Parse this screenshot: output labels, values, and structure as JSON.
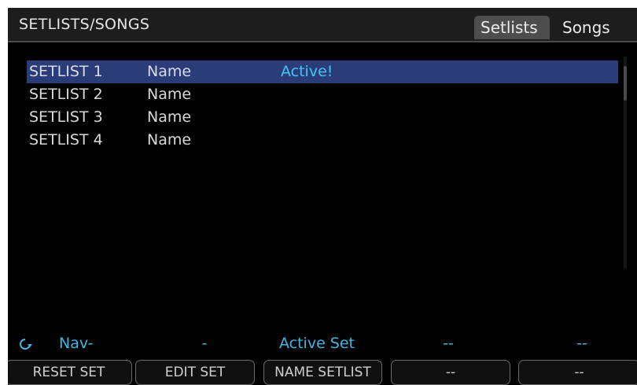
{
  "header": {
    "title": "SETLISTS/SONGS",
    "tabs": [
      "Setlists",
      "Songs"
    ],
    "active_tab": "Setlists"
  },
  "setlists": [
    {
      "label": "SETLIST 1",
      "name": "Name",
      "status": "Active!"
    },
    {
      "label": "SETLIST 2",
      "name": "Name",
      "status": ""
    },
    {
      "label": "SETLIST 3",
      "name": "Name",
      "status": ""
    },
    {
      "label": "SETLIST 4",
      "name": "Name",
      "status": ""
    }
  ],
  "selected_index": 0,
  "info_bar": {
    "icon": "rotary-knob-icon",
    "items": [
      "Nav-",
      "-",
      "Active Set",
      "--",
      "--"
    ]
  },
  "softkeys": [
    "RESET SET",
    "EDIT SET",
    "NAME SETLIST",
    "--",
    "--"
  ],
  "colors": {
    "background": "#000000",
    "header": "#1d1d1d",
    "selection": "#2b3d78",
    "accent": "#45c6f2",
    "active_tab": "#4d4d4d"
  }
}
